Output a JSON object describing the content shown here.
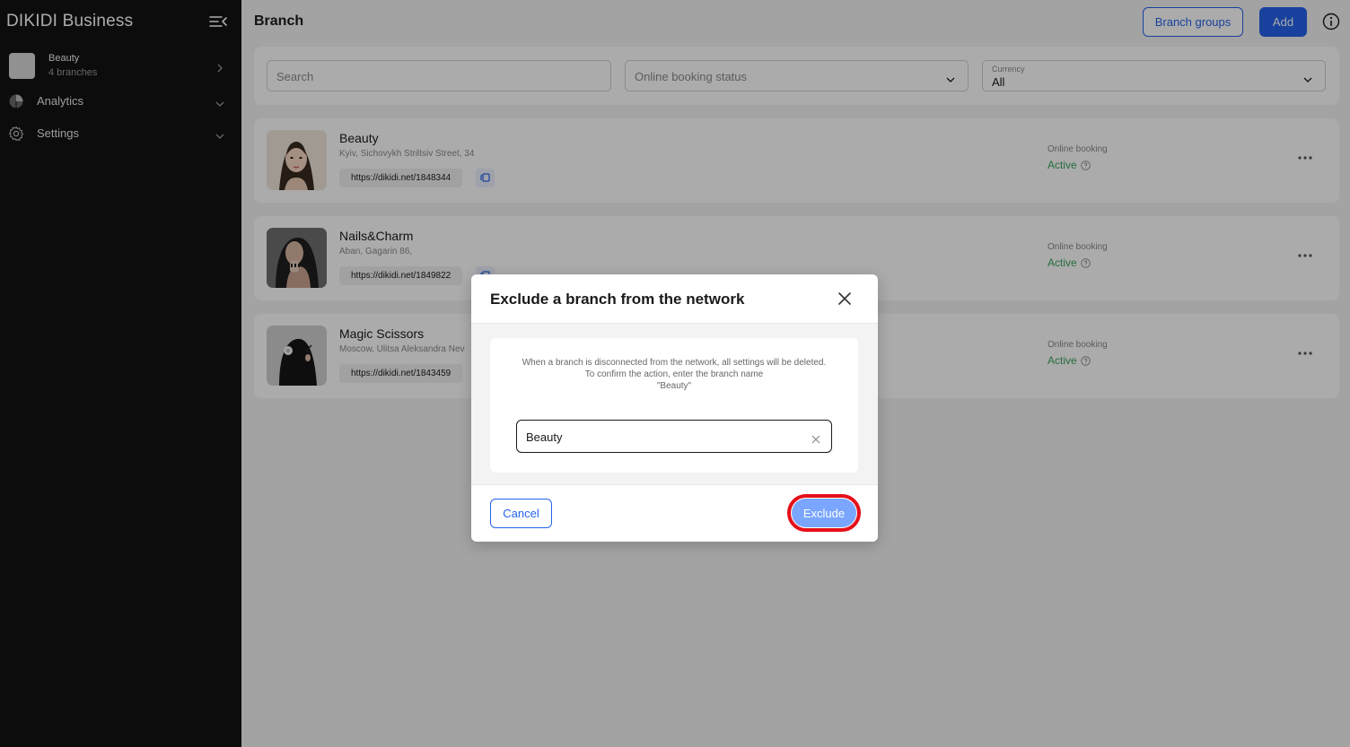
{
  "sidebar": {
    "brand": "DIKIDI Business",
    "account": {
      "name": "Beauty",
      "sub": "4 branches"
    },
    "items": [
      {
        "label": "Analytics",
        "icon": "pie-chart-icon"
      },
      {
        "label": "Settings",
        "icon": "gear-icon"
      }
    ]
  },
  "header": {
    "title": "Branch",
    "branch_groups_label": "Branch groups",
    "add_label": "Add"
  },
  "filters": {
    "search_placeholder": "Search",
    "booking_status_placeholder": "Online booking status",
    "currency_label": "Currency",
    "currency_value": "All"
  },
  "branches": [
    {
      "name": "Beauty",
      "address": "Kyiv, Sichovykh Striltsiv Street, 34",
      "link": "https://dikidi.net/1848344",
      "booking_label": "Online booking",
      "booking_status": "Active"
    },
    {
      "name": "Nails&Charm",
      "address": "Aban, Gagarin 86,",
      "link": "https://dikidi.net/1849822",
      "booking_label": "Online booking",
      "booking_status": "Active"
    },
    {
      "name": "Magic Scissors",
      "address": "Moscow, Ulitsa Aleksandra Nev",
      "link": "https://dikidi.net/1843459",
      "booking_label": "Online booking",
      "booking_status": "Active"
    }
  ],
  "modal": {
    "title": "Exclude a branch from the network",
    "message_1": "When a branch is disconnected from the network, all settings will be deleted.",
    "message_2": "To confirm the action, enter the branch name",
    "message_3": "\"Beauty\"",
    "input_value": "Beauty",
    "cancel_label": "Cancel",
    "exclude_label": "Exclude"
  },
  "colors": {
    "accent": "#2563eb",
    "active_status": "#3aa35a",
    "highlight_ring": "#e5101a",
    "exclude_button": "#7aa6ff"
  }
}
